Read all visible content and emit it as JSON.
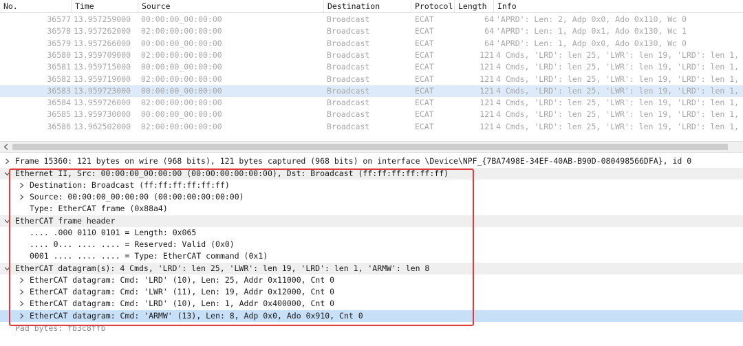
{
  "packet_list": {
    "columns": [
      "No.",
      "Time",
      "Source",
      "Destination",
      "Protocol",
      "Length",
      "Info"
    ],
    "rows": [
      {
        "no": "36577",
        "time": "13.957259000",
        "src": "00:00:00_00:00:00",
        "dst": "Broadcast",
        "proto": "ECAT",
        "len": "64",
        "info": "'APRD': Len: 2, Adp 0x0, Ado 0x110, Wc 0"
      },
      {
        "no": "36578",
        "time": "13.957262000",
        "src": "02:00:00:00:00:00",
        "dst": "Broadcast",
        "proto": "ECAT",
        "len": "64",
        "info": "'APRD': Len: 1, Adp 0x1, Ado 0x130, Wc 1"
      },
      {
        "no": "36579",
        "time": "13.957266000",
        "src": "00:00:00_00:00:00",
        "dst": "Broadcast",
        "proto": "ECAT",
        "len": "64",
        "info": "'APRD': Len: 1, Adp 0x0, Ado 0x130, Wc 0"
      },
      {
        "no": "36580",
        "time": "13.959709000",
        "src": "02:00:00:00:00:00",
        "dst": "Broadcast",
        "proto": "ECAT",
        "len": "121",
        "info": "4 Cmds, 'LRD': len 25, 'LWR': len 19, 'LRD': len 1,"
      },
      {
        "no": "36581",
        "time": "13.959715000",
        "src": "00:00:00_00:00:00",
        "dst": "Broadcast",
        "proto": "ECAT",
        "len": "121",
        "info": "4 Cmds, 'LRD': len 25, 'LWR': len 19, 'LRD': len 1,"
      },
      {
        "no": "36582",
        "time": "13.959719000",
        "src": "02:00:00:00:00:00",
        "dst": "Broadcast",
        "proto": "ECAT",
        "len": "121",
        "info": "4 Cmds, 'LRD': len 25, 'LWR': len 19, 'LRD': len 1,"
      },
      {
        "no": "36583",
        "time": "13.959723000",
        "src": "00:00:00_00:00:00",
        "dst": "Broadcast",
        "proto": "ECAT",
        "len": "121",
        "info": "4 Cmds, 'LRD': len 25, 'LWR': len 19, 'LRD': len 1,"
      },
      {
        "no": "36584",
        "time": "13.959726000",
        "src": "02:00:00:00:00:00",
        "dst": "Broadcast",
        "proto": "ECAT",
        "len": "121",
        "info": "4 Cmds, 'LRD': len 25, 'LWR': len 19, 'LRD': len 1,"
      },
      {
        "no": "36585",
        "time": "13.959730000",
        "src": "00:00:00_00:00:00",
        "dst": "Broadcast",
        "proto": "ECAT",
        "len": "121",
        "info": "4 Cmds, 'LRD': len 25, 'LWR': len 19, 'LRD': len 1,"
      },
      {
        "no": "36586",
        "time": "13.962502000",
        "src": "02:00:00:00:00:00",
        "dst": "Broadcast",
        "proto": "ECAT",
        "len": "121",
        "info": "4 Cmds, 'LRD': len 25, 'LWR': len 19, 'LRD': len 1,"
      }
    ],
    "selected_no": "36583"
  },
  "details": {
    "frame": "Frame 15360: 121 bytes on wire (968 bits), 121 bytes captured (968 bits) on interface \\Device\\NPF_{7BA7498E-34EF-40AB-B90D-080498566DFA}, id 0",
    "ethernet": "Ethernet II, Src: 00:00:00_00:00:00 (00:00:00:00:00:00), Dst: Broadcast (ff:ff:ff:ff:ff:ff)",
    "eth_dst": "Destination: Broadcast (ff:ff:ff:ff:ff:ff)",
    "eth_src": "Source: 00:00:00_00:00:00 (00:00:00:00:00:00)",
    "eth_type": "Type: EtherCAT frame (0x88a4)",
    "ecat_header": "EtherCAT frame header",
    "hdr_length": ".... .000 0110 0101 = Length: 0x065",
    "hdr_reserved": ".... 0... .... .... = Reserved: Valid (0x0)",
    "hdr_type": "0001 .... .... .... = Type: EtherCAT command (0x1)",
    "datagrams": "EtherCAT datagram(s): 4 Cmds, 'LRD': len 25, 'LWR': len 19, 'LRD': len 1, 'ARMW': len 8",
    "dg1": "EtherCAT datagram: Cmd: 'LRD' (10), Len: 25, Addr 0x11000, Cnt 0",
    "dg2": "EtherCAT datagram: Cmd: 'LWR' (11), Len: 19, Addr 0x12000, Cnt 0",
    "dg3": "EtherCAT datagram: Cmd: 'LRD' (10), Len: 1, Addr 0x400000, Cnt 0",
    "dg4": "EtherCAT datagram: Cmd: 'ARMW' (13), Len: 8, Adp 0x0, Ado 0x910, Cnt 0",
    "pad": "Pad bytes: fb3c8ffb"
  },
  "colors": {
    "selected_row": "#ddeaf9",
    "selected_tree_row": "#c7e0f8",
    "annotation_box": "#e03b3b"
  },
  "icons": {
    "expand": "chevron-right-icon",
    "scroll_left": "scroll-left-arrow-icon"
  }
}
